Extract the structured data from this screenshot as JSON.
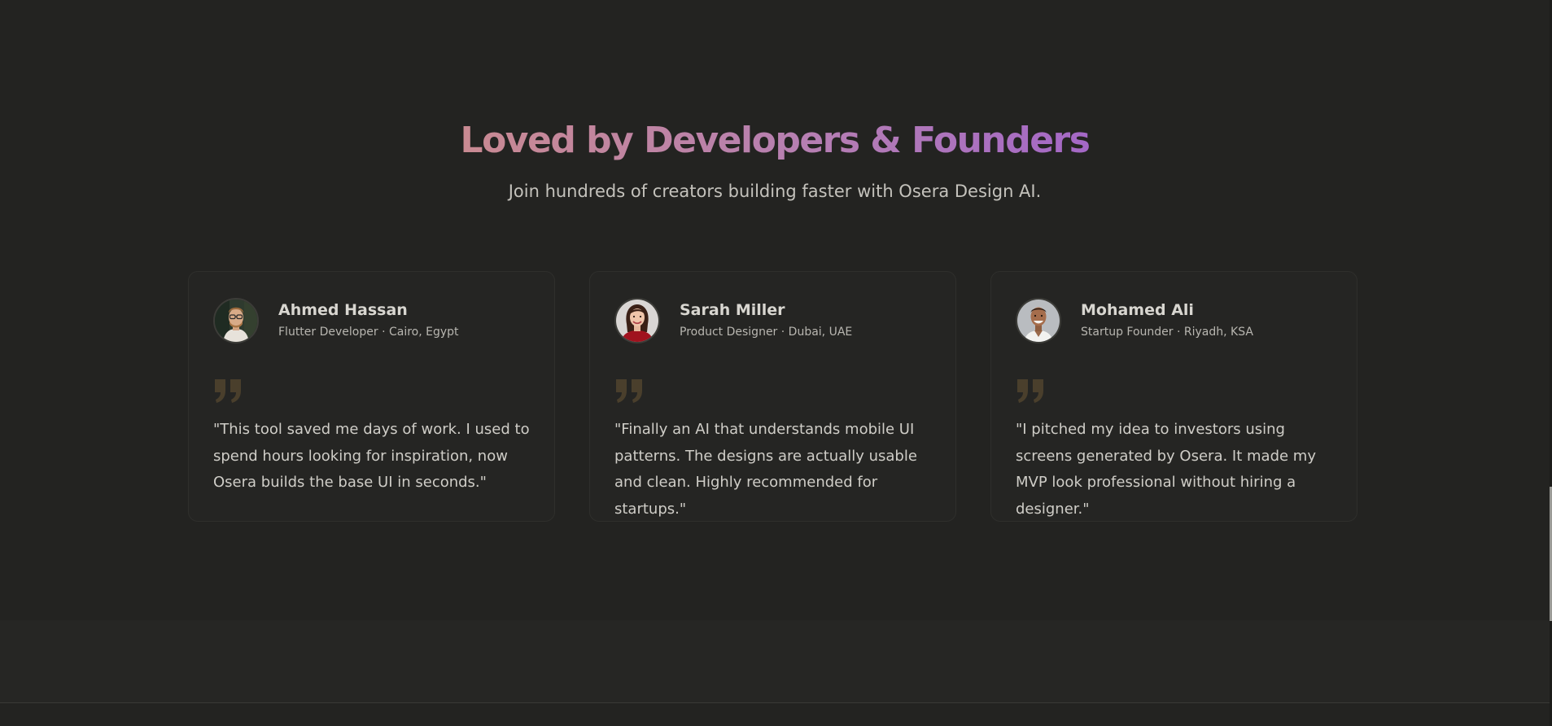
{
  "section": {
    "title": "Loved by Developers & Founders",
    "subtitle": "Join hundreds of creators building faster with Osera Design AI."
  },
  "testimonials": [
    {
      "name": "Ahmed Hassan",
      "role": "Flutter Developer · Cairo, Egypt",
      "quote": "\"This tool saved me days of work. I used to spend hours looking for inspiration, now Osera builds the base UI in seconds.\"",
      "avatar_icon": "avatar-photo"
    },
    {
      "name": "Sarah Miller",
      "role": "Product Designer · Dubai, UAE",
      "quote": "\"Finally an AI that understands mobile UI patterns. The designs are actually usable and clean. Highly recommended for startups.\"",
      "avatar_icon": "avatar-photo"
    },
    {
      "name": "Mohamed Ali",
      "role": "Startup Founder · Riyadh, KSA",
      "quote": "\"I pitched my idea to investors using screens generated by Osera. It made my MVP look professional without hiring a designer.\"",
      "avatar_icon": "avatar-photo"
    }
  ],
  "colors": {
    "background": "#232321",
    "card": "#252523",
    "heading_gradient_start": "#c98a92",
    "heading_gradient_end": "#a468c6",
    "quote_icon": "#4a3f2c"
  }
}
